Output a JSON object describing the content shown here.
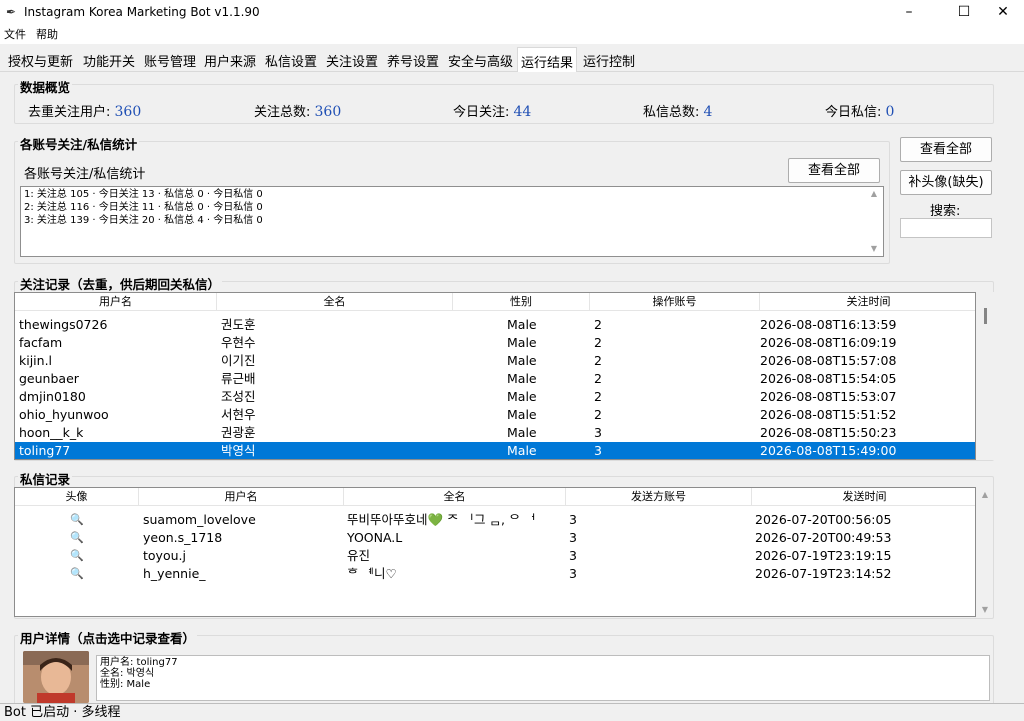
{
  "window": {
    "title": "Instagram Korea Marketing Bot v1.1.90"
  },
  "menu": [
    "文件",
    "帮助"
  ],
  "tabs": [
    "授权与更新",
    "功能开关",
    "账号管理",
    "用户来源",
    "私信设置",
    "关注设置",
    "养号设置",
    "安全与高级",
    "运行结果",
    "运行控制"
  ],
  "active_tab": "运行结果",
  "overview": {
    "title": "数据概览",
    "stats": [
      {
        "label": "去重关注用户: ",
        "value": "360"
      },
      {
        "label": "关注总数: ",
        "value": "360"
      },
      {
        "label": "今日关注: ",
        "value": "44"
      },
      {
        "label": "私信总数: ",
        "value": "4"
      },
      {
        "label": "今日私信: ",
        "value": "0"
      }
    ]
  },
  "account_stats": {
    "title": "各账号关注/私信统计",
    "subtitle": "各账号关注/私信统计",
    "view_all_label": "查看全部",
    "lines": [
      "1: 关注总 105 · 今日关注 13 · 私信总 0 · 今日私信 0",
      "2: 关注总 116 · 今日关注 11 · 私信总 0 · 今日私信 0",
      "3: 关注总 139 · 今日关注 20 · 私信总 4 · 今日私信 0"
    ]
  },
  "side_panel": {
    "view_all_label": "查看全部",
    "fill_avatar_label": "补头像(缺失)",
    "search_label": "搜索:",
    "search_value": ""
  },
  "follow_records": {
    "title": "关注记录（去重，供后期回关私信）",
    "columns": [
      "用户名",
      "全名",
      "性别",
      "操作账号",
      "关注时间"
    ],
    "rows": [
      [
        "thewings0726",
        "권도훈",
        "Male",
        "2",
        "2026-08-08T16:13:59"
      ],
      [
        "facfam",
        "우현수",
        "Male",
        "2",
        "2026-08-08T16:09:19"
      ],
      [
        "kijin.l",
        "이기진",
        "Male",
        "2",
        "2026-08-08T15:57:08"
      ],
      [
        "geunbaer",
        "류근배",
        "Male",
        "2",
        "2026-08-08T15:54:05"
      ],
      [
        "dmjin0180",
        "조성진",
        "Male",
        "2",
        "2026-08-08T15:53:07"
      ],
      [
        "ohio_hyunwoo",
        "서현우",
        "Male",
        "2",
        "2026-08-08T15:51:52"
      ],
      [
        "hoon__k_k",
        "권광훈",
        "Male",
        "3",
        "2026-08-08T15:50:23"
      ],
      [
        "toling77",
        "박영식",
        "Male",
        "3",
        "2026-08-08T15:49:00"
      ]
    ],
    "selected_index": 7
  },
  "dm_records": {
    "title": "私信记录",
    "columns": [
      "头像",
      "用户名",
      "全名",
      "发送方账号",
      "发送时间"
    ],
    "rows": [
      [
        "🔍",
        "suamom_lovelove",
        "뚜비뚜아뚜호네💚 ᄌ ᅵ그 ᆷ, ᄋ ᅥ",
        "3",
        "2026-07-20T00:56:05"
      ],
      [
        "🔍",
        "yeon.s_1718",
        "YOONA.L",
        "3",
        "2026-07-20T00:49:53"
      ],
      [
        "🔍",
        "toyou.j",
        "유진",
        "3",
        "2026-07-19T23:19:15"
      ],
      [
        "🔍",
        "h_yennie_",
        "ᄒ ᅨ니♡",
        "3",
        "2026-07-19T23:14:52"
      ]
    ]
  },
  "user_detail": {
    "title": "用户详情（点击选中记录查看）",
    "lines": [
      "用户名: toling77",
      "全名: 박영식",
      "性别: Male"
    ]
  },
  "status": "Bot 已启动 · 多线程"
}
